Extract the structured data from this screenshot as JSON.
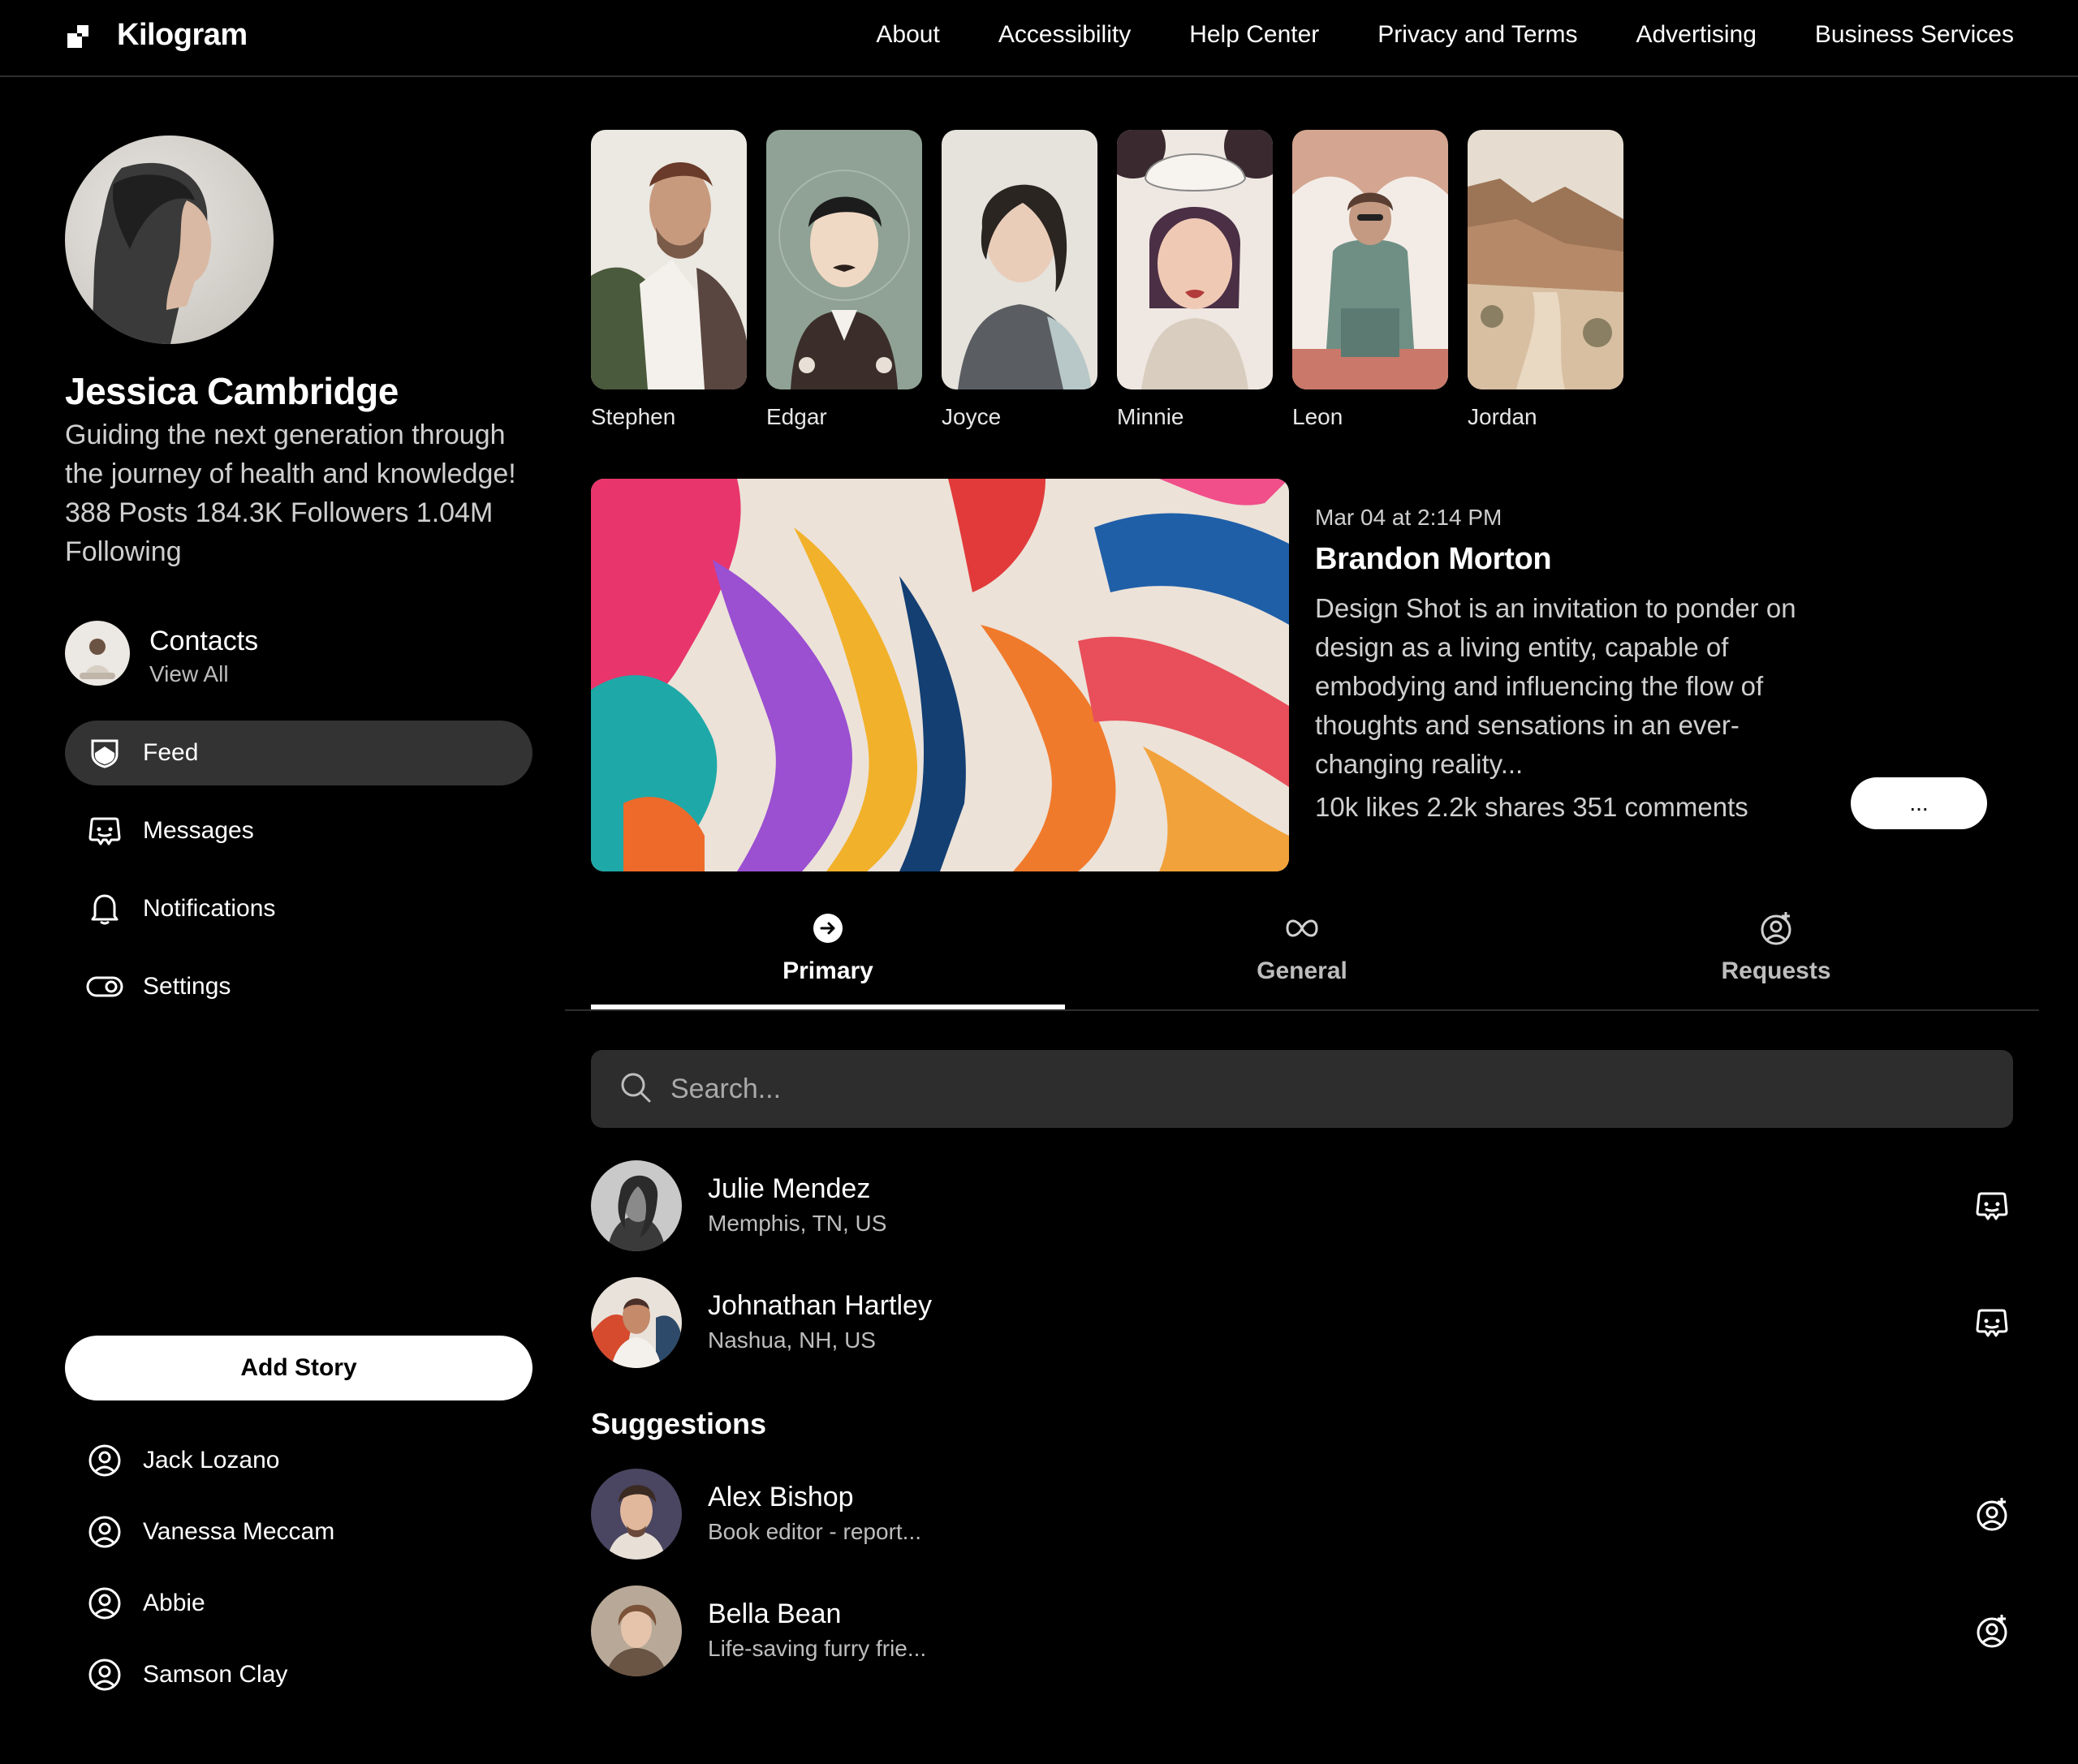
{
  "header": {
    "logo": "Kilogram",
    "nav": [
      "About",
      "Accessibility",
      "Help Center",
      "Privacy and Terms",
      "Advertising",
      "Business Services"
    ]
  },
  "profile": {
    "name": "Jessica Cambridge",
    "bio": "Guiding the next generation through the journey of health and knowledge!",
    "stats": "388 Posts 184.3K Followers 1.04M Following"
  },
  "contacts": {
    "title": "Contacts",
    "subtitle": "View All"
  },
  "menu": [
    {
      "label": "Feed",
      "icon": "shield-icon"
    },
    {
      "label": "Messages",
      "icon": "chat-icon"
    },
    {
      "label": "Notifications",
      "icon": "bell-icon"
    },
    {
      "label": "Settings",
      "icon": "toggle-icon"
    }
  ],
  "add_story": "Add Story",
  "people": [
    "Jack Lozano",
    "Vanessa Meccam",
    "Abbie",
    "Samson Clay"
  ],
  "stories": [
    "Stephen",
    "Edgar",
    "Joyce",
    "Minnie",
    "Leon",
    "Jordan"
  ],
  "post": {
    "date": "Mar 04 at 2:14 PM",
    "author": "Brandon Morton",
    "text": "Design Shot is an invitation to ponder on design as a living entity, capable of embodying and influencing the flow of thoughts and sensations in an ever-changing reality...",
    "stats": "10k likes 2.2k shares 351 comments",
    "more": "..."
  },
  "tabs": [
    {
      "label": "Primary",
      "icon": "arrow-circle-icon"
    },
    {
      "label": "General",
      "icon": "infinity-icon"
    },
    {
      "label": "Requests",
      "icon": "user-add-icon"
    }
  ],
  "search": {
    "placeholder": "Search..."
  },
  "messages": [
    {
      "name": "Julie Mendez",
      "location": "Memphis, TN, US"
    },
    {
      "name": "Johnathan Hartley",
      "location": "Nashua, NH, US"
    }
  ],
  "suggestions_title": "Suggestions",
  "suggestions": [
    {
      "name": "Alex Bishop",
      "sub": "Book editor - report..."
    },
    {
      "name": "Bella Bean",
      "sub": "Life-saving furry frie..."
    }
  ],
  "colors": {
    "background": "#000000",
    "surface": "#2d2d2d",
    "active": "#333333",
    "text": "#ffffff",
    "muted": "#bdbdbd"
  }
}
